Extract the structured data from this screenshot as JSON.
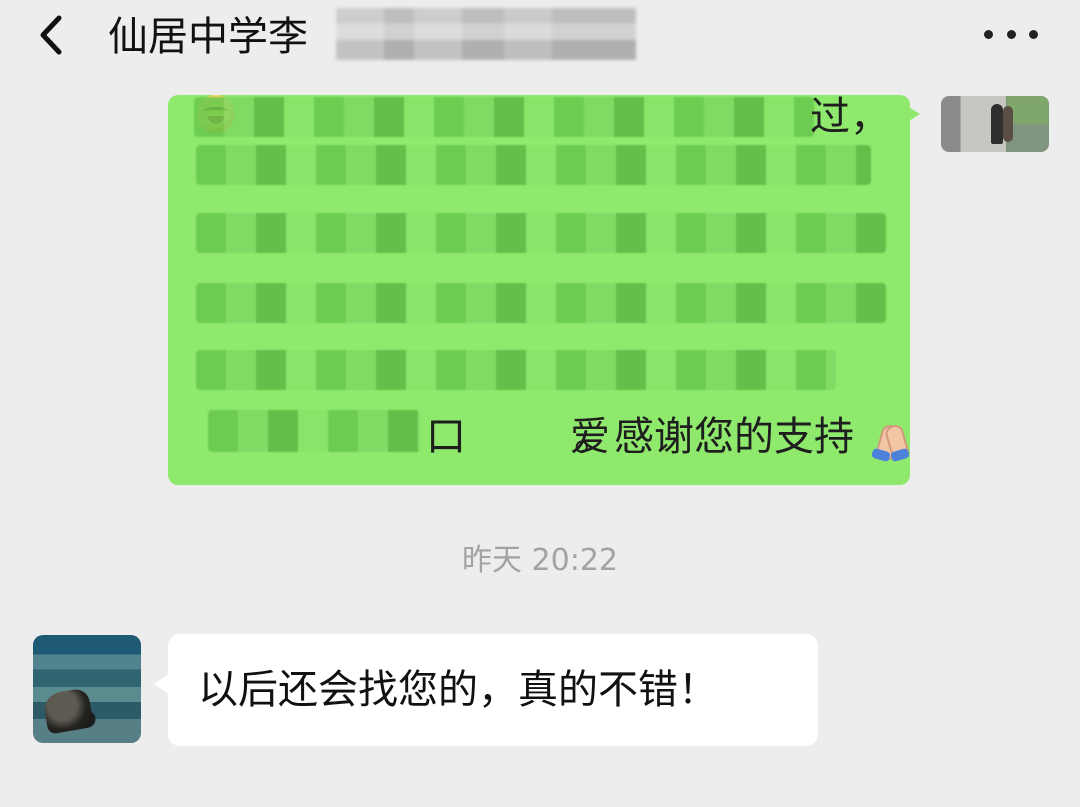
{
  "header": {
    "title": "仙居中学李"
  },
  "messages": {
    "outgoing": {
      "fragment_1": "过，",
      "fragment_2": "口",
      "fragment_3": "爱",
      "thanks": "。感谢您的支持"
    },
    "timestamp": "昨天 20:22",
    "incoming": {
      "text": "以后还会找您的，真的不错！"
    }
  },
  "icons": {
    "back": "chevron-left-icon",
    "more": "more-dots-icon",
    "emoji_1": "laughing-emoji-icon",
    "emoji_2": "praying-hands-icon"
  },
  "colors": {
    "background": "#ededed",
    "outgoing_bubble": "#8fe96d",
    "incoming_bubble": "#ffffff",
    "timestamp": "#a3a3a3"
  }
}
